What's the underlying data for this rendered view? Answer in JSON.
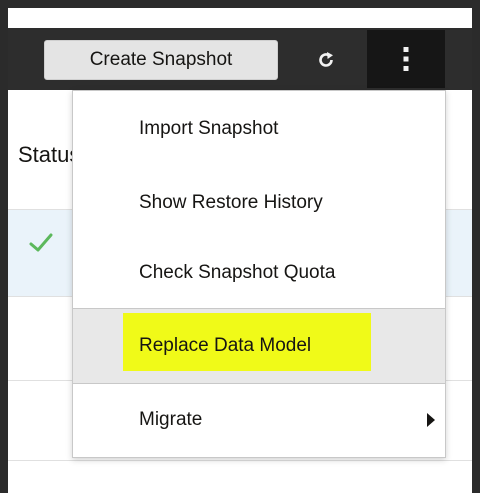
{
  "toolbar": {
    "create_label": "Create Snapshot",
    "refresh_icon": "refresh-icon",
    "more_icon": "kebab-menu-icon"
  },
  "table": {
    "status_header": "Status",
    "rows": [
      {
        "status": "success"
      },
      {
        "status": ""
      },
      {
        "status": ""
      }
    ]
  },
  "menu": {
    "items": [
      {
        "label": "Import Snapshot"
      },
      {
        "label": "Show Restore History"
      },
      {
        "label": "Check Snapshot Quota"
      },
      {
        "label": "Replace Data Model"
      },
      {
        "label": "Migrate"
      }
    ]
  },
  "colors": {
    "highlight": "#f0fa18",
    "success": "#5cb85c",
    "hover": "#e8e8e8",
    "row_selected": "#eaf3fa"
  }
}
